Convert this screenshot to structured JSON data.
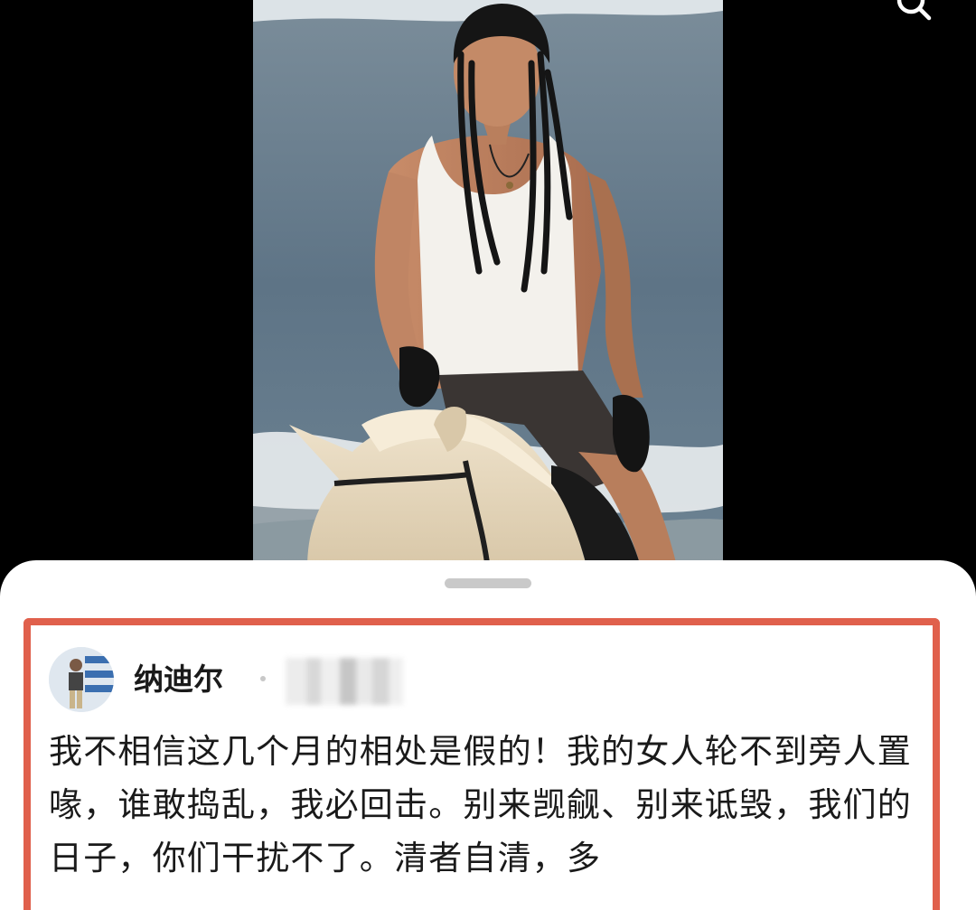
{
  "top_bar": {
    "search_icon": "search-icon"
  },
  "media": {
    "photo_subject": "photo"
  },
  "comment_sheet": {
    "comment": {
      "username": "纳迪尔",
      "separator": "·",
      "text": "我不相信这几个月的相处是假的！我的女人轮不到旁人置喙，谁敢捣乱，我必回击。别来觊觎、别来诋毁，我们的日子，你们干扰不了。清者自清，多"
    }
  },
  "colors": {
    "highlight_border": "#e0604c",
    "background": "#000000",
    "sheet": "#ffffff"
  }
}
